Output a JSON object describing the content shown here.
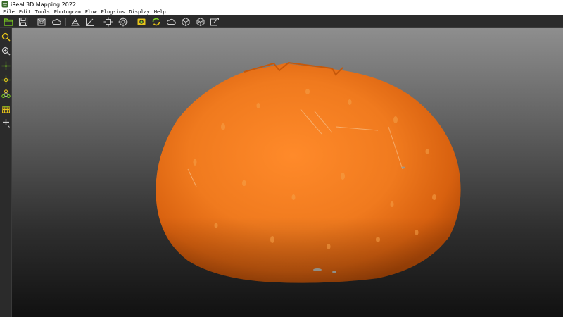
{
  "window": {
    "title": "iReal 3D Mapping 2022"
  },
  "menu": {
    "items": [
      "File",
      "Edit",
      "Tools",
      "Photogram",
      "Flow",
      "Plug-ins",
      "Display",
      "Help"
    ]
  },
  "colors": {
    "accent_green": "#7ed321",
    "accent_yellow": "#e8c51a",
    "toolbar_bg": "#2b2b2b",
    "icon_gray": "#cfcfcf",
    "pumpkin": "#f07a1e"
  },
  "toolbar": {
    "icons": [
      "open-folder-icon",
      "save-icon",
      "import-icon",
      "cloud-icon",
      "texture-icon",
      "measure-icon",
      "transform-icon",
      "target-icon",
      "photo-align-icon",
      "rebuild-icon",
      "point-cloud-icon",
      "mesh-cube-icon",
      "texture-cube-icon",
      "export-cube-icon"
    ]
  },
  "left_toolbar": {
    "icons": [
      "zoom-fit-icon",
      "zoom-region-icon",
      "pan-icon",
      "rotate-icon",
      "link-nodes-icon",
      "grid-icon",
      "add-marker-icon"
    ]
  },
  "viewport": {
    "model": "pumpkin-mesh"
  }
}
